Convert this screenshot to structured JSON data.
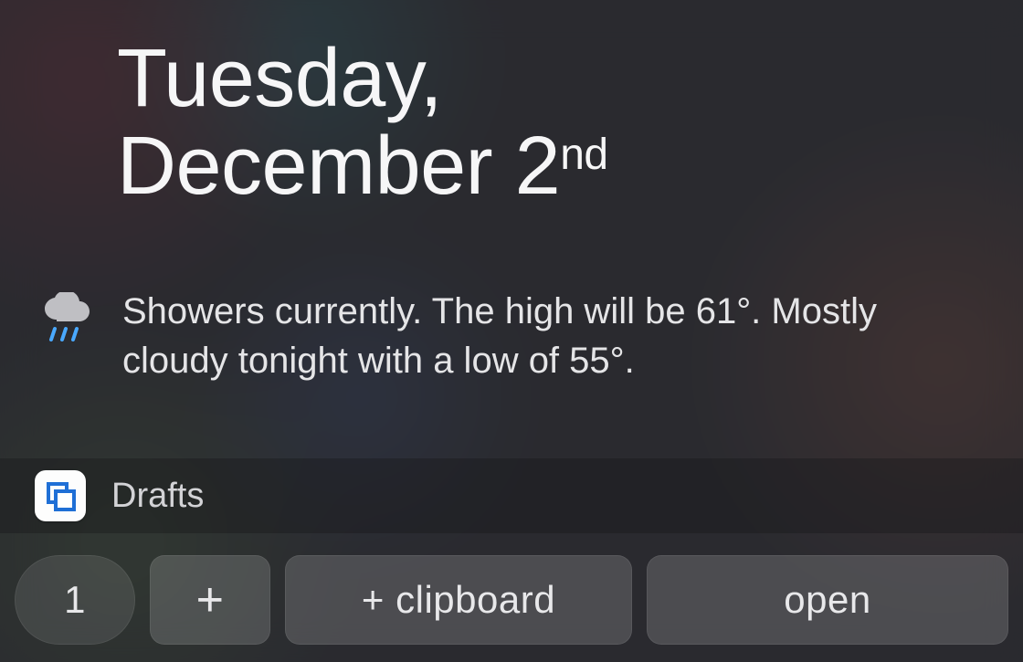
{
  "today": {
    "weekday": "Tuesday,",
    "month_day": "December 2",
    "ordinal": "nd"
  },
  "weather": {
    "icon": "showers-icon",
    "text": "Showers currently. The high will be 61°. Mostly cloudy tonight with a low of 55°."
  },
  "widget": {
    "app_name": "Drafts",
    "buttons": {
      "count": "1",
      "add": "+",
      "clipboard": "+ clipboard",
      "open": "open"
    }
  }
}
